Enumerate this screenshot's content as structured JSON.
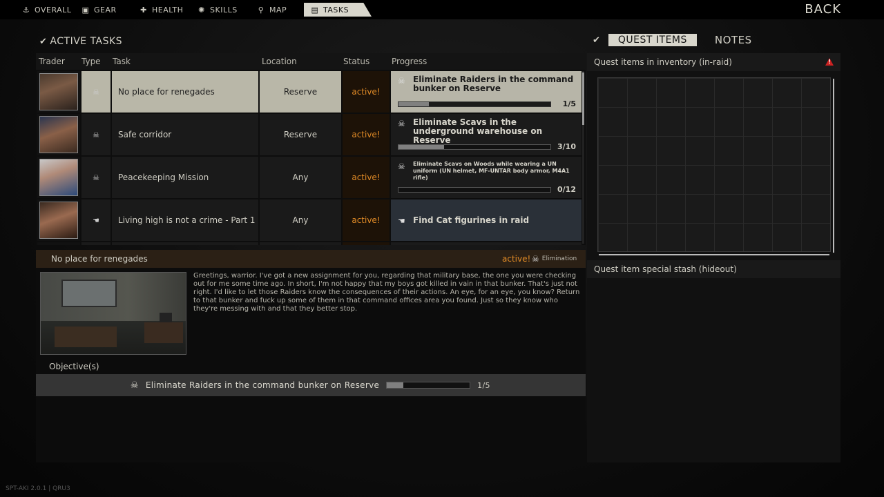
{
  "nav": {
    "tabs": [
      {
        "label": "OVERALL",
        "icon": "anchor-icon"
      },
      {
        "label": "GEAR",
        "icon": "vest-icon"
      },
      {
        "label": "HEALTH",
        "icon": "cross-icon"
      },
      {
        "label": "SKILLS",
        "icon": "bulb-icon"
      },
      {
        "label": "MAP",
        "icon": "pin-icon"
      },
      {
        "label": "TASKS",
        "icon": "clipboard-icon"
      }
    ],
    "back": "BACK"
  },
  "active_tasks_title": "ACTIVE TASKS",
  "right_tabs": {
    "quest_items": "QUEST ITEMS",
    "notes": "NOTES"
  },
  "table": {
    "headers": {
      "trader": "Trader",
      "type": "Type",
      "task": "Task",
      "location": "Location",
      "status": "Status",
      "progress": "Progress"
    },
    "rows": [
      {
        "task": "No place for renegades",
        "location": "Reserve",
        "status": "active!",
        "objective": "Eliminate Raiders in the command bunker on Reserve",
        "count": "1/5",
        "progress": 0.2
      },
      {
        "task": "Safe corridor",
        "location": "Reserve",
        "status": "active!",
        "objective": "Eliminate Scavs in the underground warehouse on Reserve",
        "count": "3/10",
        "progress": 0.3
      },
      {
        "task": "Peacekeeping Mission",
        "location": "Any",
        "status": "active!",
        "objective": "Eliminate Scavs on Woods while wearing a UN uniform (UN helmet, MF-UNTAR body armor, M4A1 rifle)",
        "count": "0/12",
        "progress": 0.0
      },
      {
        "task": "Living high is not a crime - Part 1",
        "location": "Any",
        "status": "active!",
        "objective": "Find Cat figurines in raid"
      }
    ]
  },
  "detail": {
    "title": "No place for renegades",
    "status": "active!",
    "type": "Elimination",
    "description": "Greetings, warrior. I've got a new assignment for you, regarding that military base, the one you were checking out for me some time ago. In short, I'm not happy that my boys got killed in vain in that bunker. That's just not right. I'd like to let those Raiders know the consequences of their actions. An eye, for an eye, you know? Return to that bunker and fuck up some of them in that command offices area you found. Just so they know who they're messing with and that they better stop.",
    "objectives_label": "Objective(s)",
    "objective": {
      "text": "Eliminate Raiders in the command bunker on Reserve",
      "count": "1/5",
      "progress": 0.2
    }
  },
  "right_panel": {
    "inventory_label": "Quest items in inventory (in-raid)",
    "stash_label": "Quest item special stash (hideout)"
  },
  "footer": "SPT-AKI 2.0.1 | QRU3"
}
